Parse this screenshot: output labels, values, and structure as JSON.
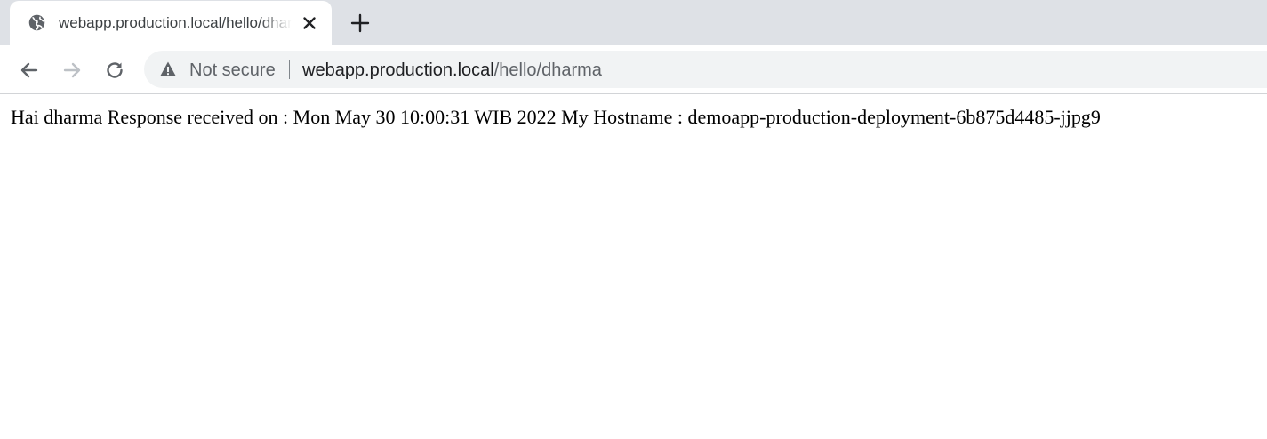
{
  "browser": {
    "tab": {
      "title": "webapp.production.local/hello/dharma",
      "favicon": "globe-icon"
    },
    "toolbar": {
      "back_icon": "arrow-left-icon",
      "forward_icon": "arrow-right-icon",
      "reload_icon": "reload-icon",
      "security_icon": "warning-triangle-icon",
      "security_label": "Not secure",
      "url_host": "webapp.production.local",
      "url_path": "/hello/dharma"
    }
  },
  "page": {
    "text": "Hai dharma Response received on : Mon May 30 10:00:31 WIB 2022 My Hostname : demoapp-production-deployment-6b875d4485-jjpg9"
  },
  "colors": {
    "tab_strip": "#dee1e6",
    "omnibox": "#f1f3f4",
    "text_primary": "#202124",
    "text_secondary": "#5f6368"
  }
}
